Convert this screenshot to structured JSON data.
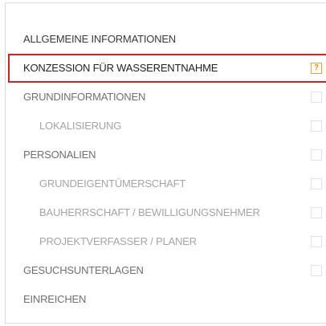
{
  "nav": {
    "items": [
      {
        "label": "ALLGEMEINE INFORMATIONEN"
      },
      {
        "label": "KONZESSION FÜR WASSERENTNAHME",
        "status": "?"
      },
      {
        "label": "GRUNDINFORMATIONEN"
      },
      {
        "label": "LOKALISIERUNG"
      },
      {
        "label": "PERSONALIEN"
      },
      {
        "label": "GRUNDEIGENTÜMERSCHAFT"
      },
      {
        "label": "BAUHERRSCHAFT / BEWILLIGUNGSNEHMER"
      },
      {
        "label": "PROJEKTVERFASSER / PLANER"
      },
      {
        "label": "GESUCHSUNTERLAGEN"
      },
      {
        "label": "EINREICHEN"
      }
    ]
  },
  "colors": {
    "active_border": "#d9201e",
    "warning": "#e98a12",
    "dark_text": "#3a3a3a",
    "section_text": "#707070",
    "sub_text": "#a4a4a4"
  }
}
